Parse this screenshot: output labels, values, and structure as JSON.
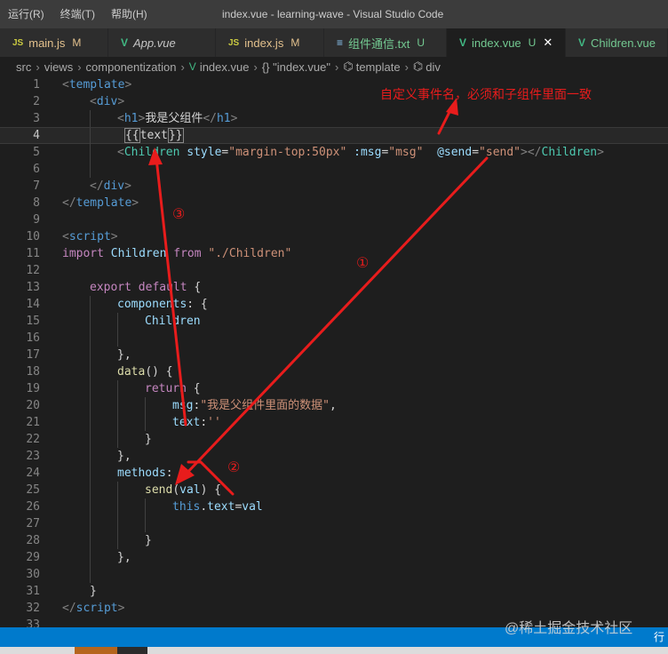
{
  "menu": [
    "运行(R)",
    "终端(T)",
    "帮助(H)"
  ],
  "window_title": "index.vue - learning-wave - Visual Studio Code",
  "tabs": [
    {
      "icon": "JS",
      "label": "main.js",
      "status": "M",
      "active": false
    },
    {
      "icon": "V",
      "label": "App.vue",
      "status": "",
      "active": false
    },
    {
      "icon": "JS",
      "label": "index.js",
      "status": "M",
      "active": false
    },
    {
      "icon": "≡",
      "label": "组件通信.txt",
      "status": "U",
      "active": false
    },
    {
      "icon": "V",
      "label": "index.vue",
      "status": "U",
      "active": true
    },
    {
      "icon": "V",
      "label": "Children.vue",
      "status": "U",
      "active": false
    }
  ],
  "close_glyph": "✕",
  "breadcrumb": [
    "src",
    "views",
    "componentization",
    "index.vue",
    "{} \"index.vue\"",
    "template",
    "div"
  ],
  "line_numbers": [
    "1",
    "2",
    "3",
    "4",
    "5",
    "6",
    "7",
    "8",
    "9",
    "10",
    "11",
    "12",
    "13",
    "14",
    "15",
    "16",
    "17",
    "18",
    "19",
    "20",
    "21",
    "22",
    "23",
    "24",
    "25",
    "26",
    "27",
    "28",
    "29",
    "30",
    "31",
    "32",
    "33"
  ],
  "code": {
    "l1": [
      "<",
      "template",
      ">"
    ],
    "l2": [
      "<",
      "div",
      ">"
    ],
    "l3": [
      "<",
      "h1",
      ">",
      "我是父组件",
      "</",
      "h1",
      ">"
    ],
    "l4": [
      "{{",
      "text",
      "}}"
    ],
    "l5": [
      "<",
      "Children",
      "style",
      "=",
      "\"margin-top:50px\"",
      ":msg",
      "=",
      "\"msg\"",
      "@send",
      "=",
      "\"send\"",
      "></",
      "Children",
      ">"
    ],
    "l7": [
      "</",
      "div",
      ">"
    ],
    "l8": [
      "</",
      "template",
      ">"
    ],
    "l10": [
      "<",
      "script",
      ">"
    ],
    "l11": [
      "import",
      "Children",
      "from",
      "\"./Children\""
    ],
    "l13": [
      "export",
      "default",
      "{"
    ],
    "l14": [
      "components",
      ": {"
    ],
    "l15": [
      "Children"
    ],
    "l17": [
      "},"
    ],
    "l18": [
      "data",
      "() {"
    ],
    "l19": [
      "return",
      "{"
    ],
    "l20": [
      "msg",
      ":",
      "\"我是父组件里面的数据\"",
      ","
    ],
    "l21": [
      "text",
      ":",
      "''"
    ],
    "l22": [
      "}"
    ],
    "l23": [
      "},"
    ],
    "l24": [
      "methods",
      ":"
    ],
    "l25": [
      "send",
      "(",
      "val",
      ") {"
    ],
    "l26": [
      "this",
      ".",
      "text",
      "=",
      "val"
    ],
    "l28": [
      "}"
    ],
    "l29": [
      "},"
    ],
    "l31": [
      "}"
    ],
    "l32": [
      "</",
      "script",
      ">"
    ]
  },
  "annotations": {
    "note": "自定义事件名，必须和子组件里面一致",
    "step1": "①",
    "step2": "②",
    "step3": "③"
  },
  "watermark": "@稀土掘金技术社区",
  "status_right": "行",
  "colors": {
    "annotation": "#e81c1c",
    "statusbar": "#007acc",
    "editor_bg": "#1e1e1e"
  }
}
